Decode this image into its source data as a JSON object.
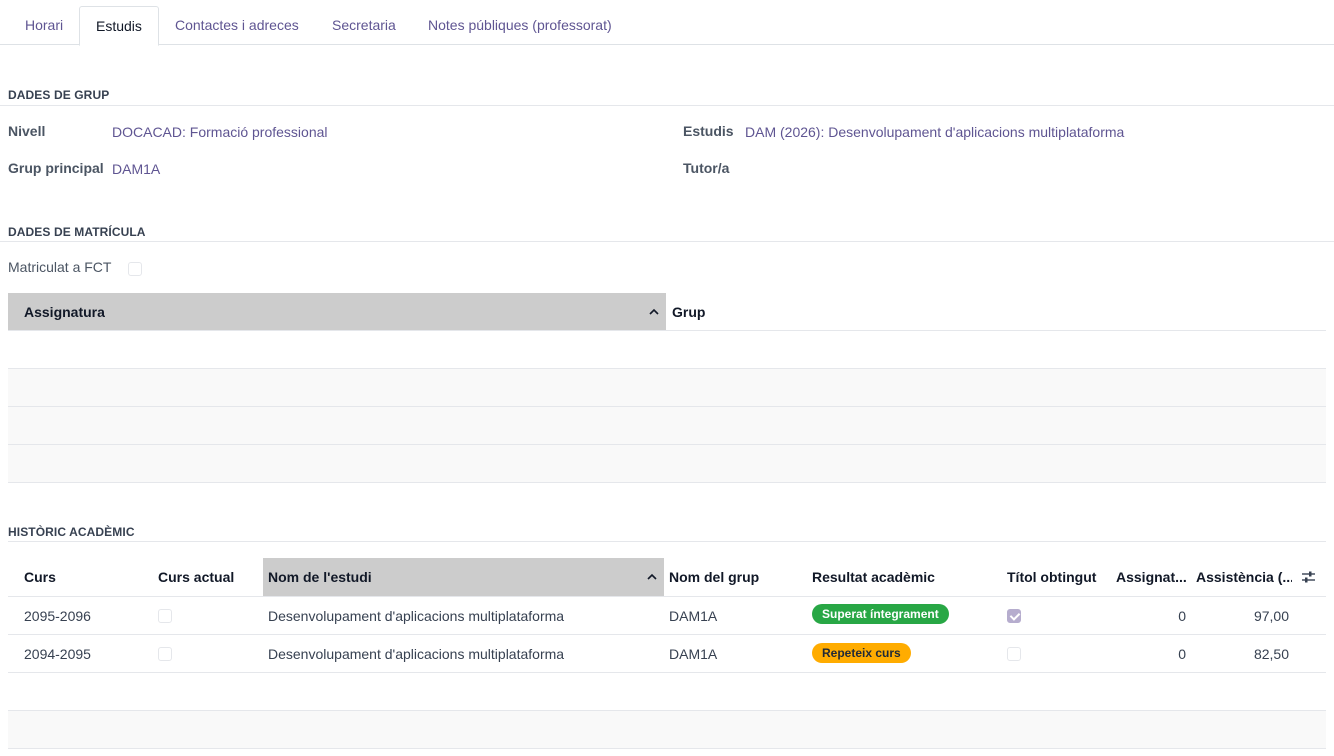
{
  "tabs": [
    {
      "label": "Horari"
    },
    {
      "label": "Estudis"
    },
    {
      "label": "Contactes i adreces"
    },
    {
      "label": "Secretaria"
    },
    {
      "label": "Notes públiques (professorat)"
    }
  ],
  "group_section": {
    "title": "DADES DE GRUP",
    "level_label": "Nivell",
    "level_value": "DOCACAD: Formació professional",
    "main_group_label": "Grup principal",
    "main_group_value": "DAM1A",
    "studies_label": "Estudis",
    "studies_value": "DAM (2026): Desenvolupament d'aplicacions multiplataforma",
    "tutor_label": "Tutor/a"
  },
  "enrollment_section": {
    "title": "DADES DE MATRÍCULA",
    "fct_label": "Matriculat a FCT",
    "fct_checked": false,
    "table_headers": {
      "subject": "Assignatura",
      "group": "Grup"
    }
  },
  "history_section": {
    "title": "HISTÒRIC ACADÈMIC",
    "headers": {
      "course": "Curs",
      "current": "Curs actual",
      "study_name": "Nom de l'estudi",
      "group_name": "Nom del grup",
      "result": "Resultat acadèmic",
      "degree": "Títol obtingut",
      "subjects": "Assignat...",
      "attendance": "Assistència (..."
    },
    "rows": [
      {
        "course": "2095-2096",
        "current": false,
        "study_name": "Desenvolupament d'aplicacions multiplataforma",
        "group_name": "DAM1A",
        "result": "Superat íntegrament",
        "result_color": "#28a745",
        "degree": true,
        "subjects": "0",
        "attendance": "97,00"
      },
      {
        "course": "2094-2095",
        "current": false,
        "study_name": "Desenvolupament d'aplicacions multiplataforma",
        "group_name": "DAM1A",
        "result": "Repeteix curs",
        "result_color": "#ffac00",
        "degree": false,
        "subjects": "0",
        "attendance": "82,50"
      }
    ]
  },
  "colors": {
    "accent": "#5f5592",
    "sorted_header": "#cccccc"
  }
}
